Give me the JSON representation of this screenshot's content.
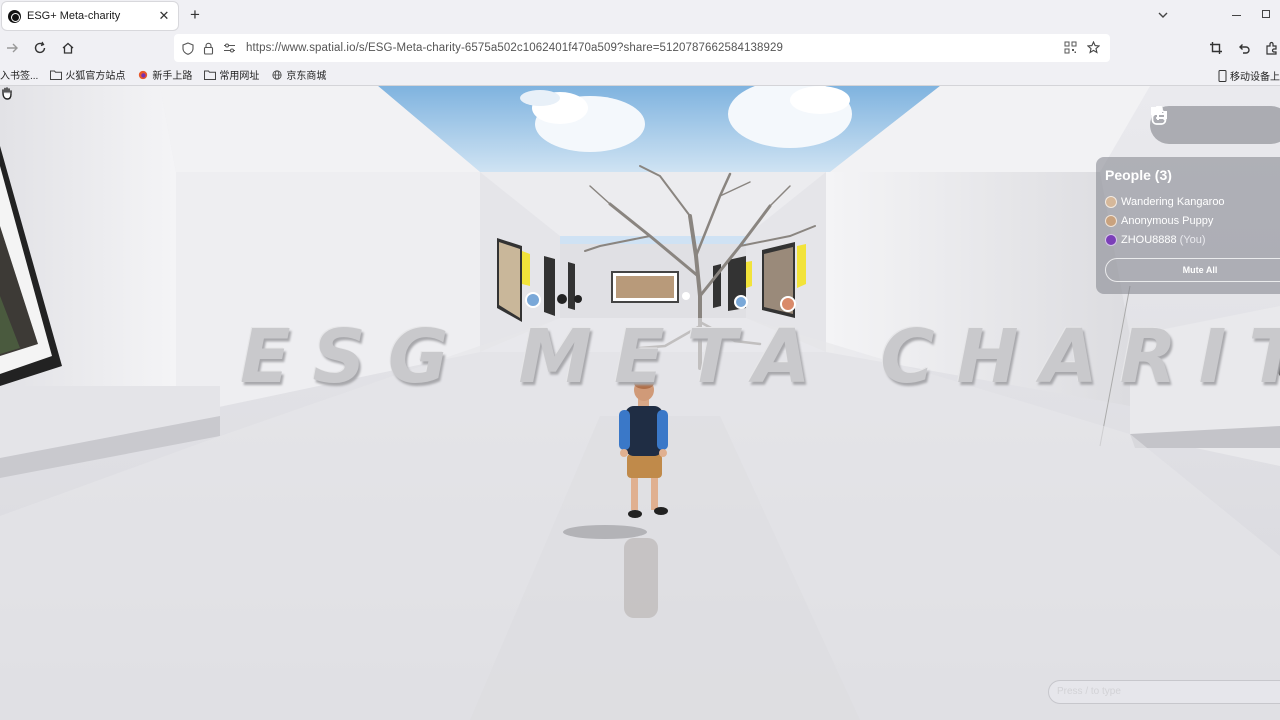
{
  "tab": {
    "title": "ESG+ Meta-charity",
    "close": "✕"
  },
  "browser": {
    "new_tab": "+",
    "url": "https://www.spatial.io/s/ESG-Meta-charity-6575a502c1062401f470a509?share=5120787662584138929",
    "url_host": "www.spatial.io"
  },
  "bookmarks": {
    "items": [
      {
        "label": "入书签..."
      },
      {
        "label": "火狐官方站点"
      },
      {
        "label": "新手上路"
      },
      {
        "label": "常用网址"
      },
      {
        "label": "京东商城"
      }
    ],
    "mobile_label": "移动设备上"
  },
  "scene": {
    "title_text": "ESG META CHARITY"
  },
  "people_panel": {
    "title": "People (3)",
    "people": [
      {
        "name": "Wandering Kangaroo",
        "suffix": "",
        "avatar_color": "#d6b89a"
      },
      {
        "name": "Anonymous Puppy",
        "suffix": "",
        "avatar_color": "#c9a27e"
      },
      {
        "name": "ZHOU8888",
        "suffix": "(You)",
        "avatar_color": "#7b3fb8"
      }
    ],
    "mute_all": "Mute All"
  },
  "chat": {
    "placeholder": "Press / to type"
  },
  "colors": {
    "sky": "#9cc6e8",
    "wall": "#eeeef1",
    "floor": "#e2e2e6",
    "accent_yellow": "#f2e33a"
  }
}
